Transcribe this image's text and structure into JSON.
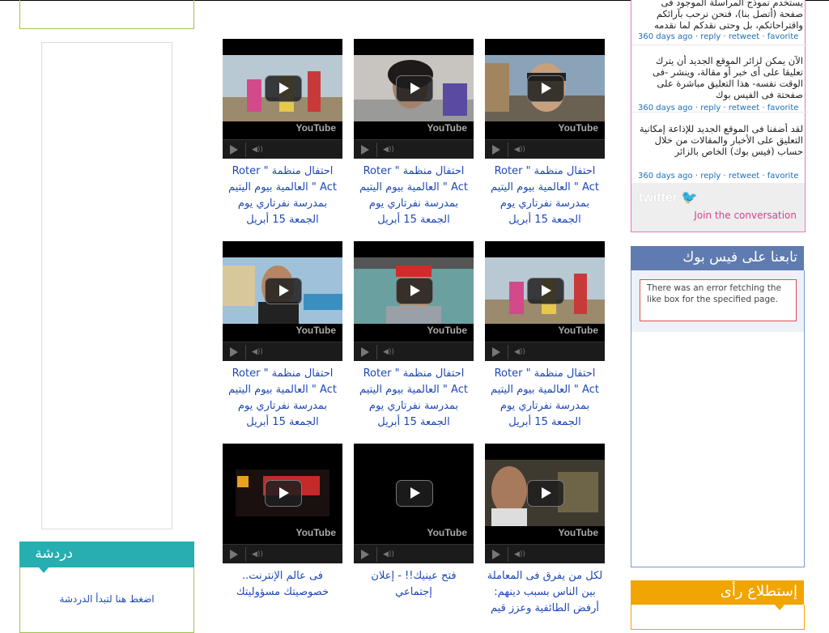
{
  "left": {
    "chat": {
      "title": "دردشة",
      "link": "اضغط هنا لتبدأ الدردشة"
    }
  },
  "videos": [
    {
      "caption": "احتفال منظمة \" Roter Act \" العالمية بيوم اليتيم بمدرسة نفرتاري يوم الجمعة 15 أبريل",
      "logo": "YouTube"
    },
    {
      "caption": "احتفال منظمة \" Roter Act \" العالمية بيوم اليتيم بمدرسة نفرتاري يوم الجمعة 15 أبريل",
      "logo": "YouTube"
    },
    {
      "caption": "احتفال منظمة \" Roter Act \" العالمية بيوم اليتيم بمدرسة نفرتاري يوم الجمعة 15 أبريل",
      "logo": "YouTube"
    },
    {
      "caption": "احتفال منظمة \" Roter Act \" العالمية بيوم اليتيم بمدرسة نفرتاري يوم الجمعة 15 أبريل",
      "logo": "YouTube"
    },
    {
      "caption": "احتفال منظمة \" Roter Act \" العالمية بيوم اليتيم بمدرسة نفرتاري يوم الجمعة 15 أبريل",
      "logo": "YouTube"
    },
    {
      "caption": "احتفال منظمة \" Roter Act \" العالمية بيوم اليتيم بمدرسة نفرتاري يوم الجمعة 15 أبريل",
      "logo": "YouTube"
    },
    {
      "caption": "لكل من يفرق فى المعاملة بين الناس بسبب دينهم: أرفض الطائفية وعزز قيم",
      "logo": "YouTube"
    },
    {
      "caption": "فتح عينيك!! - إعلان إجتماعي",
      "logo": "YouTube"
    },
    {
      "caption": "فى عالم الإنترنت.. خصوصيتك مسؤوليتك",
      "logo": "YouTube"
    }
  ],
  "twitter": {
    "tweets": [
      {
        "text": "يستخدم نموذج المراسلة الموجود فى صفحة (أتصل بنا)، فنحن نرحب بآرائكم واقتراحاتكم، بل وحتى نقدكم لما نقدمه",
        "time": "360 days ago",
        "reply": "reply",
        "retweet": "retweet",
        "favorite": "favorite"
      },
      {
        "text": "الآن يمكن لزائر الموقع الجديد أن يترك تعليقا على أى خبر أو مقالة، وينشر -فى الوقت نفسه- هذا التعليق مباشرة على صفحتة فى الفيس بوك",
        "time": "360 days ago",
        "reply": "reply",
        "retweet": "retweet",
        "favorite": "favorite"
      },
      {
        "text": "لقد أضفنا فى الموقع الجديد للإذاعة إمكانية التعليق على الأخبار والمقالات من خلال حساب (فيس بوك) الخاص بالزائر",
        "time": "360 days ago",
        "reply": "reply",
        "retweet": "retweet",
        "favorite": "favorite"
      }
    ],
    "logo": "twitter",
    "join": "Join the conversation"
  },
  "facebook": {
    "title": "تابعنا على فيس بوك",
    "error": "There was an error fetching the like box for the specified page."
  },
  "poll": {
    "title": "إستطلاع رأى"
  },
  "colors": {
    "chat_header": "#26aeb0",
    "facebook_header": "#5f7bb0",
    "poll_header": "#f1a500",
    "twitter_border": "#e17abf",
    "link": "#1d48b5"
  }
}
